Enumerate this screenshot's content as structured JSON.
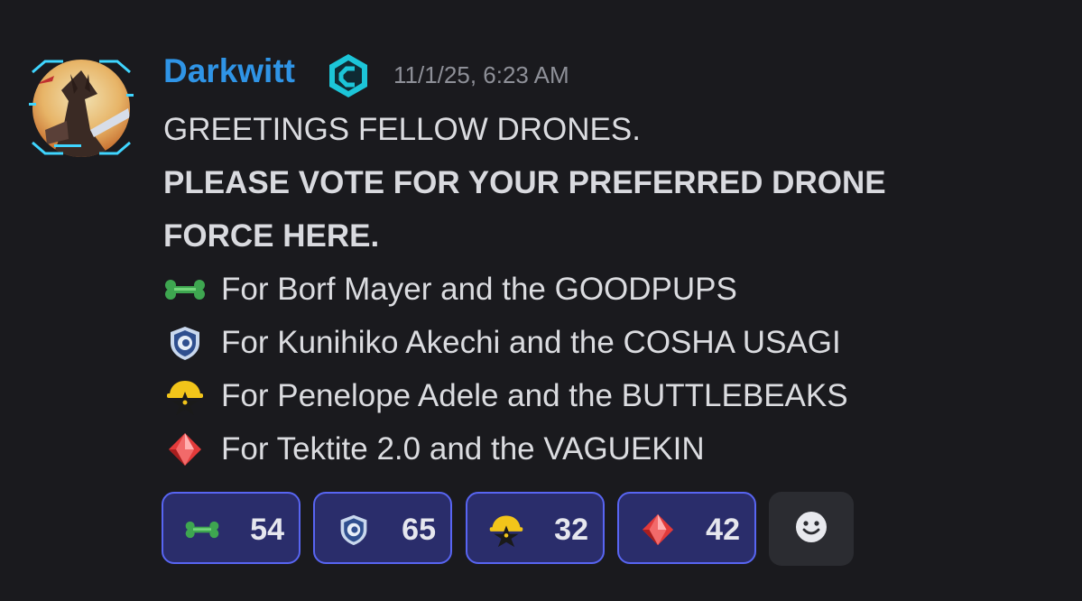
{
  "message": {
    "author": "Darkwitt",
    "timestamp": "11/1/25, 6:23 AM",
    "lines": [
      "GREETINGS FELLOW DRONES.",
      "PLEASE VOTE FOR YOUR PREFERRED DRONE",
      "FORCE HERE."
    ],
    "options": [
      {
        "icon": "bone-icon",
        "text": "For Borf Mayer and the GOODPUPS"
      },
      {
        "icon": "shield-icon",
        "text": "For Kunihiko Akechi and the COSHA USAGI"
      },
      {
        "icon": "hardhat-star-icon",
        "text": "For Penelope Adele and the BUTTLEBEAKS"
      },
      {
        "icon": "red-gem-icon",
        "text": "For Tektite 2.0 and the VAGUEKIN"
      }
    ]
  },
  "reactions": [
    {
      "icon": "bone-icon",
      "count": "54"
    },
    {
      "icon": "shield-icon",
      "count": "65"
    },
    {
      "icon": "hardhat-star-icon",
      "count": "32"
    },
    {
      "icon": "red-gem-icon",
      "count": "42"
    }
  ],
  "colors": {
    "background": "#1a1a1e",
    "username": "#2f94e6",
    "text": "#dbdce0",
    "timestamp": "#8e9098",
    "reaction_border": "#5865f2",
    "reaction_bg": "#2a2d6b"
  }
}
